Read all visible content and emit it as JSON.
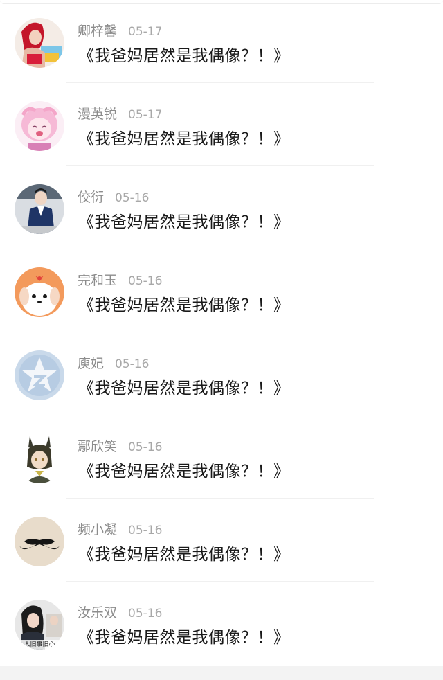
{
  "comments": [
    {
      "name": "卿梓馨",
      "date": "05-17",
      "text": "《我爸妈居然是我偶像？！》",
      "avatar_icon": "girl-red-hair-avatar"
    },
    {
      "name": "漫英锐",
      "date": "05-17",
      "text": "《我爸妈居然是我偶像？！》",
      "avatar_icon": "pink-anime-girl-avatar"
    },
    {
      "name": "佼衍",
      "date": "05-16",
      "text": "《我爸妈居然是我偶像？！》",
      "avatar_icon": "man-in-suit-avatar"
    },
    {
      "name": "完和玉",
      "date": "05-16",
      "text": "《我爸妈居然是我偶像？！》",
      "avatar_icon": "cartoon-dog-avatar"
    },
    {
      "name": "庾妃",
      "date": "05-16",
      "text": "《我爸妈居然是我偶像？！》",
      "avatar_icon": "star-logo-avatar"
    },
    {
      "name": "鄢欣笑",
      "date": "05-16",
      "text": "《我爸妈居然是我偶像？！》",
      "avatar_icon": "anime-character-avatar"
    },
    {
      "name": "频小凝",
      "date": "05-16",
      "text": "《我爸妈居然是我偶像？！》",
      "avatar_icon": "mustache-avatar"
    },
    {
      "name": "汝乐双",
      "date": "05-16",
      "text": "《我爸妈居然是我偶像？！》",
      "avatar_icon": "woman-photo-avatar",
      "avatar_caption": "人旧事旧心"
    }
  ]
}
